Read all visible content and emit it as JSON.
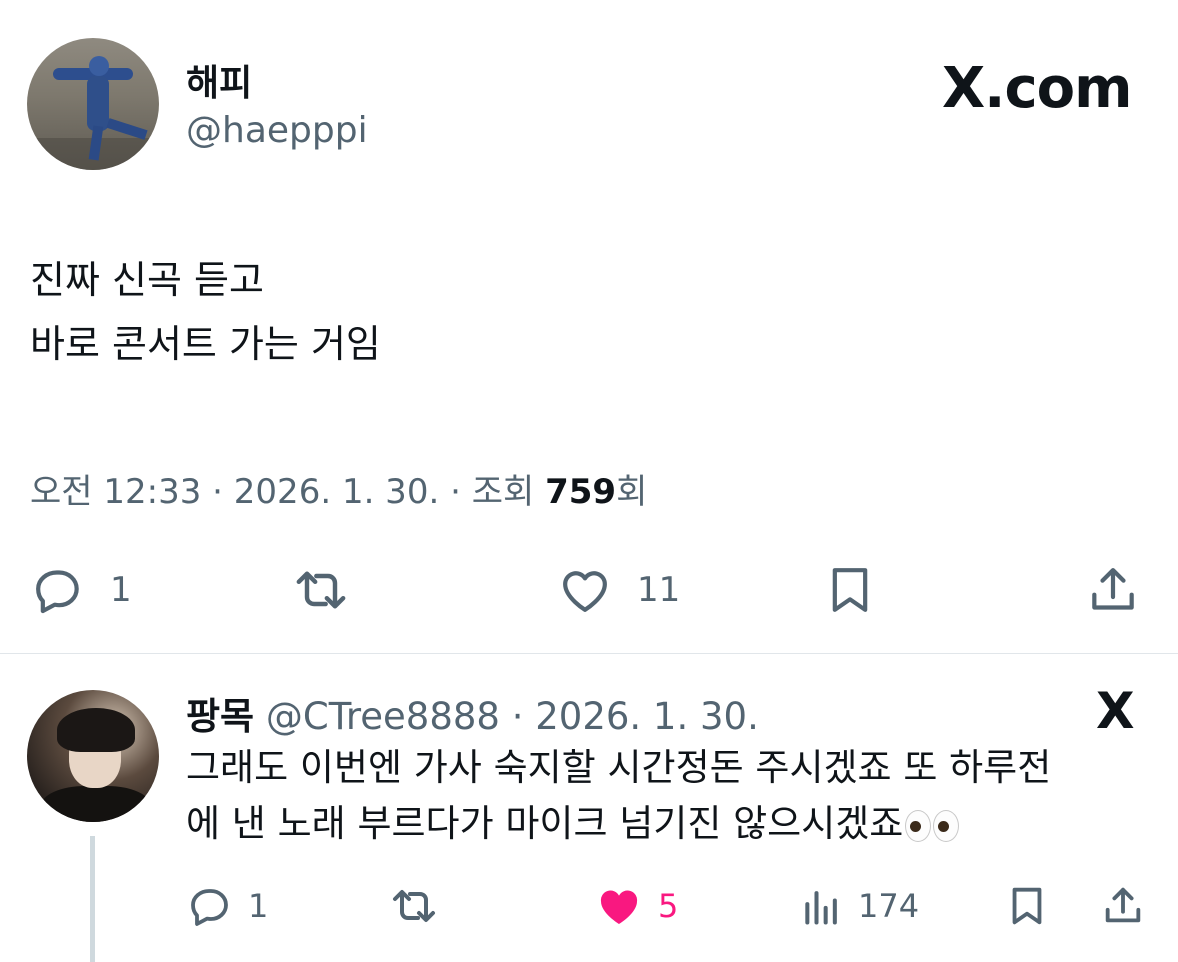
{
  "main_tweet": {
    "author_name": "해피",
    "author_handle": "@haepppi",
    "brand": "X.com",
    "text_lines": [
      "진짜 신곡 듣고",
      "바로 콘서트 가는 거임"
    ],
    "time": "오전 12:33",
    "date": "2026. 1. 30.",
    "views_label": "조회",
    "views_count": "759",
    "views_suffix": "회",
    "separator": "·",
    "actions": {
      "reply_count": "1",
      "retweet_count": "",
      "like_count": "11"
    }
  },
  "reply": {
    "author_name": "팡목",
    "author_handle": "@CTree8888",
    "date": "2026. 1. 30.",
    "separator": "·",
    "x_logo": "X",
    "text_lines": [
      "그래도 이번엔 가사 숙지할 시간정돈 주시겠죠 또 하루전",
      "에 낸 노래 부르다가 마이크 넘기진 않으시겠죠"
    ],
    "emoji": "eyes-emoji",
    "actions": {
      "reply_count": "1",
      "like_count": "5",
      "views_count": "174",
      "liked": true
    }
  },
  "colors": {
    "text": "#0f1419",
    "secondary": "#536471",
    "like_pink": "#f91880",
    "divider": "#e1e6ea"
  }
}
